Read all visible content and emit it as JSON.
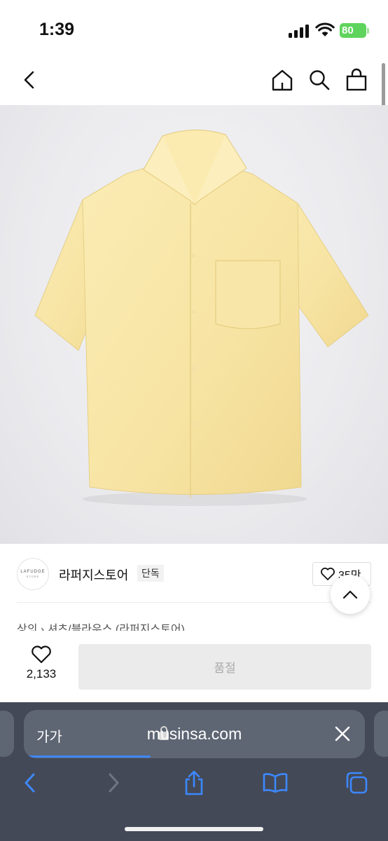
{
  "status_bar": {
    "time": "1:39",
    "battery_level": "80",
    "battery_color": "#5fd45c"
  },
  "header": {
    "icons": [
      "back-icon",
      "home-icon",
      "search-icon",
      "shopping-bag-icon"
    ]
  },
  "product": {
    "image_alt_color": "#f7e4a3"
  },
  "brand": {
    "logo_text": "LAFUDGE",
    "logo_subtext": "STORE",
    "name": "라퍼지스토어",
    "badge": "단독",
    "likes": "35만"
  },
  "breadcrumb": {
    "category": "상의",
    "separator": "›",
    "subcategory": "셔츠/블라우스 (라퍼지스토어)"
  },
  "purchase_bar": {
    "wish_count": "2,133",
    "soldout_label": "품절"
  },
  "safari": {
    "aa_label": "가가",
    "url": "musinsa.com",
    "accent_color": "#3d88ff",
    "toolbar": [
      "back-icon",
      "forward-icon",
      "share-icon",
      "bookmarks-icon",
      "tabs-icon"
    ]
  }
}
